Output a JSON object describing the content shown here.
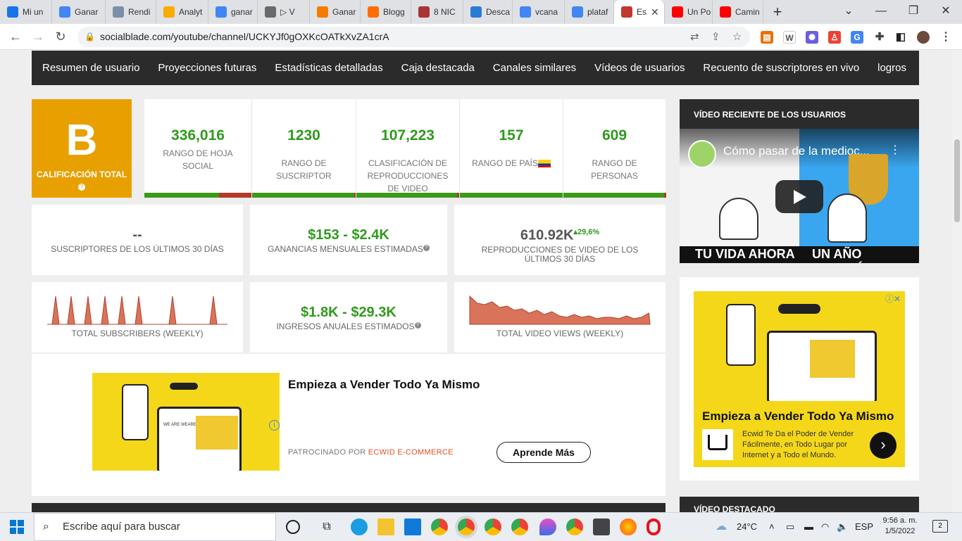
{
  "tabs": [
    {
      "label": "Mi un",
      "icon": "drive-icon",
      "color": "#1a73e8"
    },
    {
      "label": "Ganar",
      "icon": "docs-icon",
      "color": "#4285f4"
    },
    {
      "label": "Rendi",
      "icon": "wifi-icon",
      "color": "#7c8fa8"
    },
    {
      "label": "Analyt",
      "icon": "analytics-icon",
      "color": "#f9ab00"
    },
    {
      "label": "ganar",
      "icon": "google-icon",
      "color": "#4285f4"
    },
    {
      "label": "▷ V",
      "icon": "video-icon",
      "color": "#6a6a6a"
    },
    {
      "label": "Ganar",
      "icon": "blogger-b-icon",
      "color": "#f57c00"
    },
    {
      "label": "Blogg",
      "icon": "blogger-icon",
      "color": "#ff6d00"
    },
    {
      "label": "8 NIC",
      "icon": "avatar-icon",
      "color": "#a33"
    },
    {
      "label": "Desca",
      "icon": "download-icon",
      "color": "#2a7ad8"
    },
    {
      "label": "vcana",
      "icon": "google-icon",
      "color": "#4285f4"
    },
    {
      "label": "plataf",
      "icon": "google-icon",
      "color": "#4285f4"
    },
    {
      "label": "Es",
      "icon": "socialblade-icon",
      "color": "#c0392b"
    },
    {
      "label": "Un Po",
      "icon": "youtube-icon",
      "color": "#ff0000"
    },
    {
      "label": "Camin",
      "icon": "youtube-icon",
      "color": "#ff0000"
    }
  ],
  "address": {
    "url": "socialblade.com/youtube/channel/UCKYJf0gOXKcOATkXvZA1crA"
  },
  "nav": [
    "Resumen de usuario",
    "Proyecciones futuras",
    "Estadísticas detalladas",
    "Caja destacada",
    "Canales similares",
    "Vídeos de usuarios",
    "Recuento de suscriptores en vivo",
    "logros"
  ],
  "grade": {
    "letter": "B",
    "label": "CALIFICACIÓN TOTAL",
    "help": "?"
  },
  "ranks": [
    {
      "value": "336,016",
      "label": "RANGO DE HOJA SOCIAL",
      "fill": 0.7
    },
    {
      "value": "1230",
      "label": "RANGO DE SUSCRIPTOR",
      "fill": 0.98
    },
    {
      "value": "107,223",
      "label": "CLASIFICACIÓN DE REPRODUCCIONES DE VIDEO",
      "fill": 0.97
    },
    {
      "value": "157",
      "label": "RANGO DE PAÍS",
      "fill": 1.0
    },
    {
      "value": "609",
      "label": "RANGO DE PERSONAS",
      "fill": 0.98
    }
  ],
  "stats": {
    "subs30": {
      "value": "--",
      "label": "SUSCRIPTORES DE LOS ÚLTIMOS 30 DÍAS"
    },
    "monthly": {
      "value": "$153 - $2.4K",
      "label": "GANANCIAS MENSUALES ESTIMADAS"
    },
    "views30": {
      "value": "610.92K",
      "change": "▴29,6%",
      "label": "REPRODUCCIONES DE VIDEO DE LOS ÚLTIMOS 30 DÍAS"
    },
    "yearly": {
      "value": "$1.8K - $29.3K",
      "label": "INGRESOS ANUALES ESTIMADOS"
    }
  },
  "sparks": {
    "subs_caption": "TOTAL SUBSCRIBERS (WEEKLY)",
    "views_caption": "TOTAL VIDEO VIEWS (WEEKLY)"
  },
  "ad_main": {
    "title": "Empieza a Vender Todo Ya Mismo",
    "sponsor_prefix": "PATROCINADO POR",
    "sponsor_name": "ECWID E-COMMERCE",
    "cta": "Aprende Más",
    "brand": "WE ARE WEAREL"
  },
  "side": {
    "recent_header": "VÍDEO RECIENTE DE LOS USUARIOS",
    "video_title": "Cómo pasar de la medioc...",
    "video_caption_left": "TU VIDA AHORA",
    "video_caption_right": "UN AÑO DESPUÉS",
    "ad_title": "Empieza a Vender Todo Ya Mismo",
    "ad_body": "Ecwid Te Da el Poder de Vender Fácilmente, en Todo Lugar por Internet y a Todo el Mundo.",
    "featured_header": "VÍDEO DESTACADO"
  },
  "taskbar": {
    "search_placeholder": "Escribe aquí para buscar",
    "weather": "24°C",
    "lang": "ESP",
    "time": "9:56 a. m.",
    "date": "1/5/2022",
    "notifications": "2"
  },
  "colors": {
    "grade": "#e8a000",
    "green": "#2f9a1d",
    "chart": "#d9735a",
    "nav": "#2b2b2b",
    "ad_yellow": "#f5d71a"
  }
}
